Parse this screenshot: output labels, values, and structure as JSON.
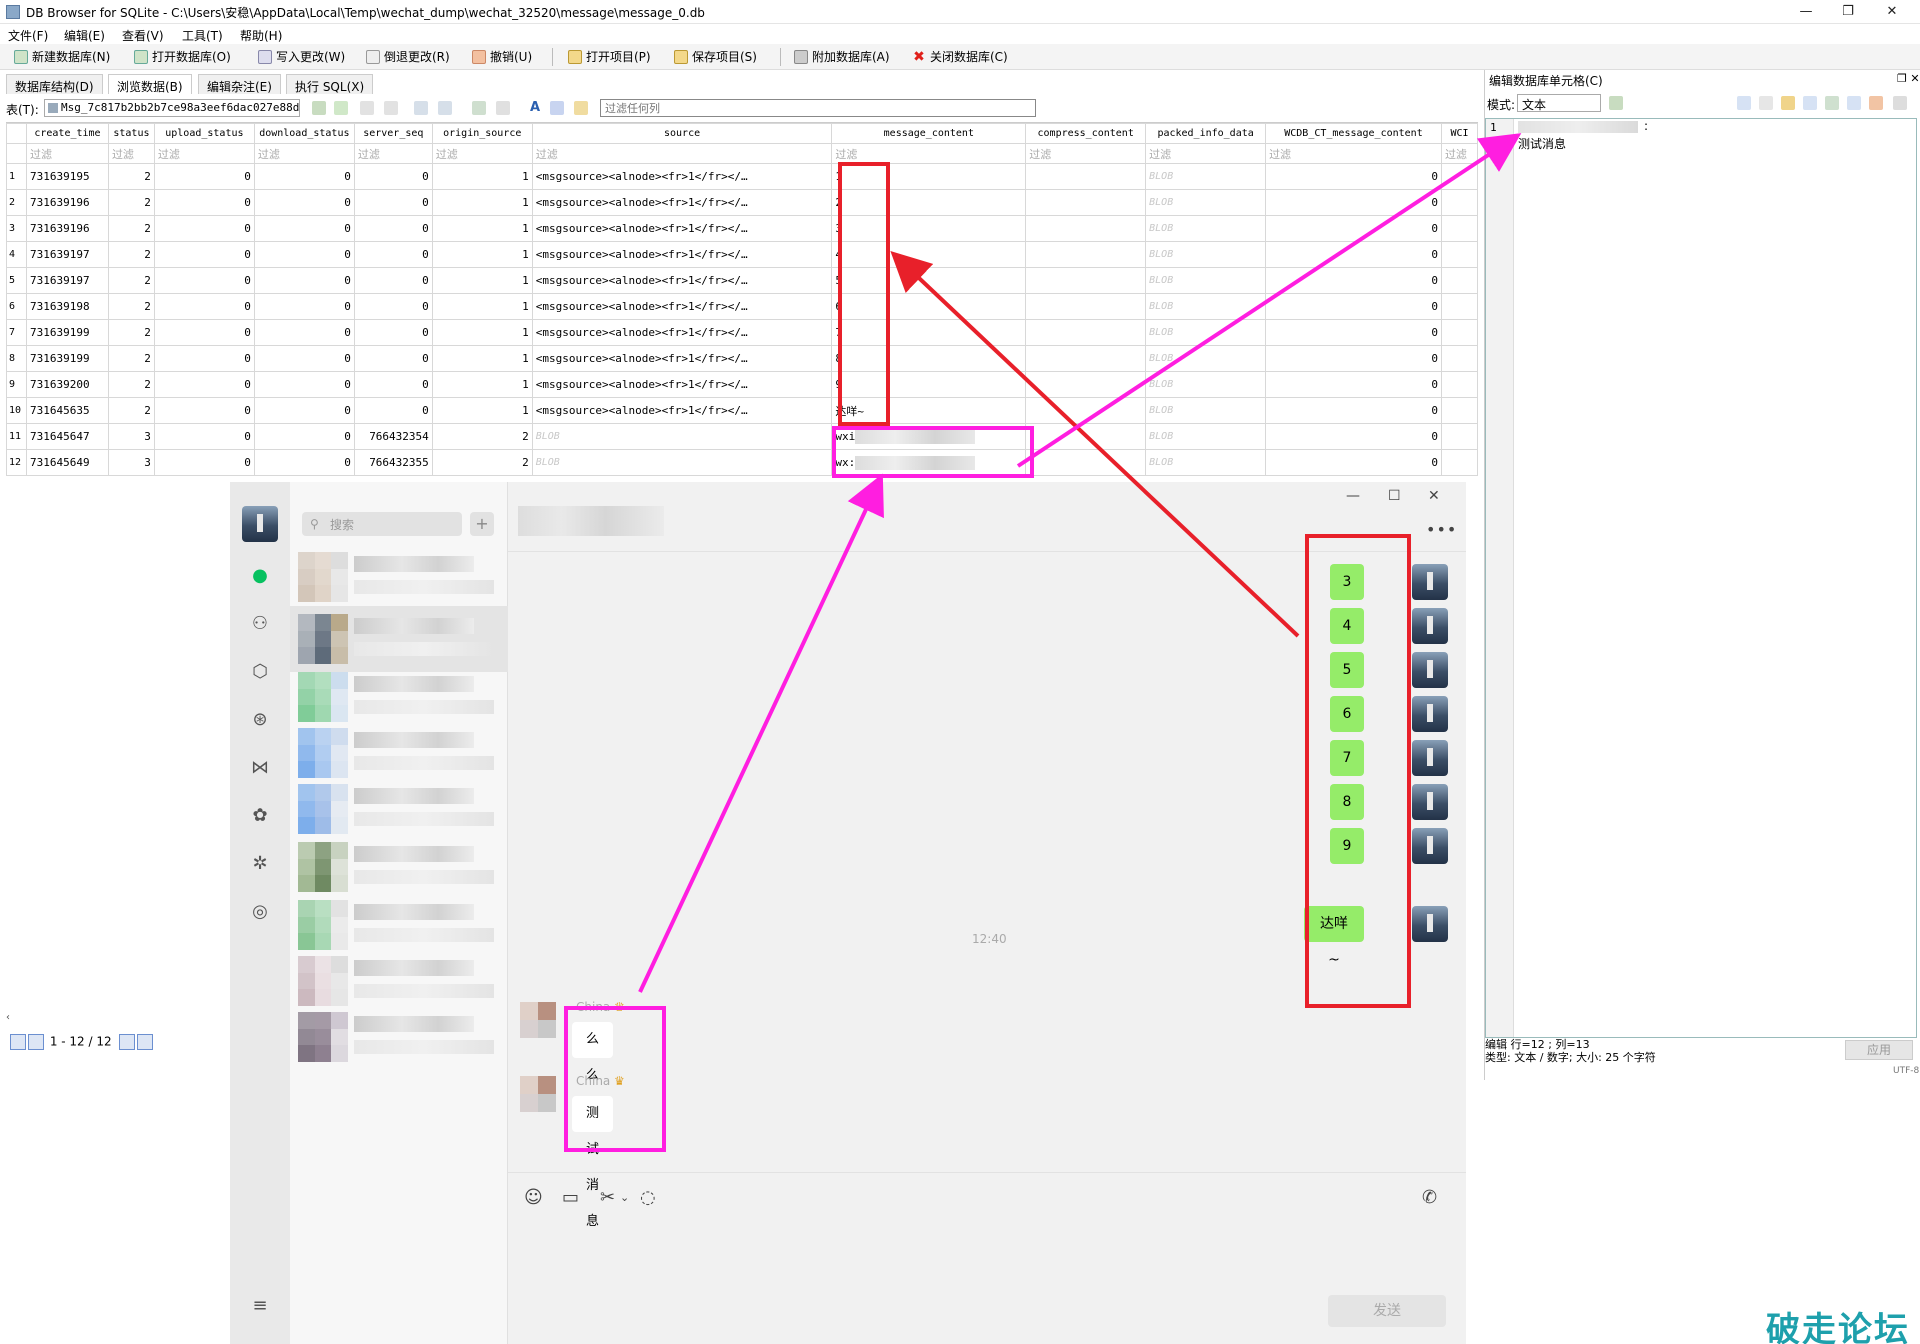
{
  "window": {
    "title": "DB Browser for SQLite - C:\\Users\\安稳\\AppData\\Local\\Temp\\wechat_dump\\wechat_32520\\message\\message_0.db",
    "minimize": "—",
    "maximize": "❐",
    "close": "✕"
  },
  "menu": [
    "文件(F)",
    "编辑(E)",
    "查看(V)",
    "工具(T)",
    "帮助(H)"
  ],
  "toolbar": [
    "新建数据库(N)",
    "打开数据库(O)",
    "写入更改(W)",
    "倒退更改(R)",
    "撤销(U)",
    "打开项目(P)",
    "保存项目(S)",
    "附加数据库(A)",
    "关闭数据库(C)"
  ],
  "tabs": [
    "数据库结构(D)",
    "浏览数据(B)",
    "编辑杂注(E)",
    "执行 SQL(X)"
  ],
  "table_label": "表(T):",
  "table_name": "Msg_7c817b2bb2b7ce98a3eef6dac027e88d",
  "filter_all_placeholder": "过滤任何列",
  "columns": [
    "create_time",
    "status",
    "upload_status",
    "download_status",
    "server_seq",
    "origin_source",
    "source",
    "message_content",
    "compress_content",
    "packed_info_data",
    "WCDB_CT_message_content",
    "WCI"
  ],
  "filter_label": "过滤",
  "rows": [
    [
      "1",
      "731639195",
      "2",
      "0",
      "0",
      "0",
      "1",
      "<msgsource><alnode><fr>1</fr></…",
      "1",
      "",
      "BLOB",
      "0"
    ],
    [
      "2",
      "731639196",
      "2",
      "0",
      "0",
      "0",
      "1",
      "<msgsource><alnode><fr>1</fr></…",
      "2",
      "",
      "BLOB",
      "0"
    ],
    [
      "3",
      "731639196",
      "2",
      "0",
      "0",
      "0",
      "1",
      "<msgsource><alnode><fr>1</fr></…",
      "3",
      "",
      "BLOB",
      "0"
    ],
    [
      "4",
      "731639197",
      "2",
      "0",
      "0",
      "0",
      "1",
      "<msgsource><alnode><fr>1</fr></…",
      "4",
      "",
      "BLOB",
      "0"
    ],
    [
      "5",
      "731639197",
      "2",
      "0",
      "0",
      "0",
      "1",
      "<msgsource><alnode><fr>1</fr></…",
      "5",
      "",
      "BLOB",
      "0"
    ],
    [
      "6",
      "731639198",
      "2",
      "0",
      "0",
      "0",
      "1",
      "<msgsource><alnode><fr>1</fr></…",
      "6",
      "",
      "BLOB",
      "0"
    ],
    [
      "7",
      "731639199",
      "2",
      "0",
      "0",
      "0",
      "1",
      "<msgsource><alnode><fr>1</fr></…",
      "7",
      "",
      "BLOB",
      "0"
    ],
    [
      "8",
      "731639199",
      "2",
      "0",
      "0",
      "0",
      "1",
      "<msgsource><alnode><fr>1</fr></…",
      "8",
      "",
      "BLOB",
      "0"
    ],
    [
      "9",
      "731639200",
      "2",
      "0",
      "0",
      "0",
      "1",
      "<msgsource><alnode><fr>1</fr></…",
      "9",
      "",
      "BLOB",
      "0"
    ],
    [
      "10",
      "731645635",
      "2",
      "0",
      "0",
      "0",
      "1",
      "<msgsource><alnode><fr>1</fr></…",
      "达咩~",
      "",
      "BLOB",
      "0"
    ],
    [
      "11",
      "731645647",
      "3",
      "0",
      "0",
      "766432354",
      "2",
      "BLOB",
      "wxi",
      "",
      "BLOB",
      "0"
    ],
    [
      "12",
      "731645649",
      "3",
      "0",
      "0",
      "766432355",
      "2",
      "BLOB",
      "wx:",
      "",
      "BLOB",
      "0"
    ]
  ],
  "pager": "1 - 12 / 12",
  "edit_panel": {
    "title": "编辑数据库单元格(C)",
    "mode_label": "模式:",
    "mode_value": "文本",
    "lines": [
      ":",
      "测试消息"
    ],
    "line_nums": [
      "1",
      "2"
    ],
    "status_line1": "编辑 行=12 ; 列=13",
    "status_line2": "类型: 文本 / 数字; 大小: 25 个字符",
    "apply": "应用",
    "encoding": "UTF-8"
  },
  "wechat": {
    "search_placeholder": "搜索",
    "plus": "+",
    "sent_messages": [
      "3",
      "4",
      "5",
      "6",
      "7",
      "8",
      "9",
      "达咩~"
    ],
    "time": "12:40",
    "received": [
      {
        "nick": "China",
        "text": "么么哒"
      },
      {
        "nick": "China",
        "text": "测试消息"
      }
    ],
    "send_button": "发送",
    "more": "•••",
    "win_min": "—",
    "win_max": "☐",
    "win_close": "✕"
  },
  "watermark": "破走论坛",
  "colors": {
    "annotation_red": "#e8202a",
    "annotation_magenta": "#ff1ee0",
    "wechat_green": "#95ec69",
    "watermark": "#1ea0ac"
  }
}
